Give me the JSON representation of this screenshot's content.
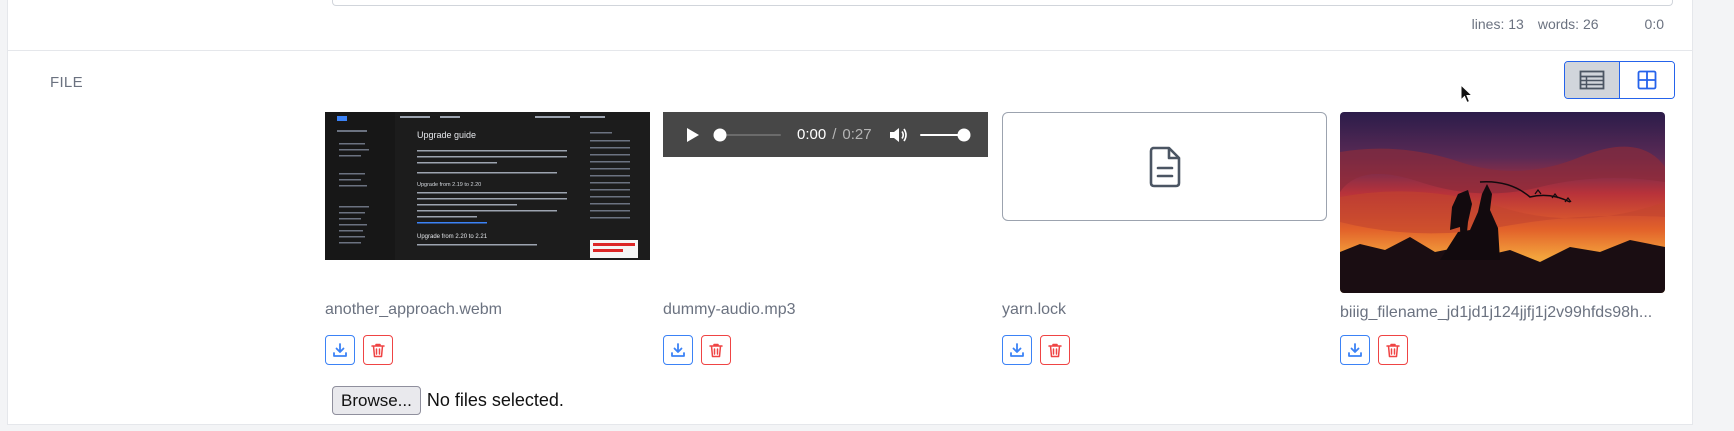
{
  "editor_stats": {
    "lines": "lines: 13",
    "words": "words: 26",
    "cursor": "0:0"
  },
  "field": {
    "label": "FILE"
  },
  "view_toggle": {
    "options": [
      "list-view",
      "grid-view"
    ],
    "active": "grid-view"
  },
  "files": [
    {
      "name": "another_approach.webm",
      "type": "video",
      "preview": {
        "title": "Upgrade guide",
        "section_1": "Upgrade from 2.19 to 2.20",
        "section_2": "Upgrade from 2.20 to 2.21"
      }
    },
    {
      "name": "dummy-audio.mp3",
      "type": "audio",
      "player": {
        "current_time": "0:00",
        "separator": "/",
        "duration": "0:27",
        "progress": 0.0,
        "volume": 1.0
      }
    },
    {
      "name": "yarn.lock",
      "type": "document"
    },
    {
      "name": "biiig_filename_jd1jd1j124jjfj1j2v99hfds98h...",
      "type": "image"
    }
  ],
  "upload": {
    "button_label": "Browse...",
    "status": "No files selected."
  },
  "colors": {
    "accent_blue": "#3b82f6",
    "danger_red": "#ef4444"
  }
}
